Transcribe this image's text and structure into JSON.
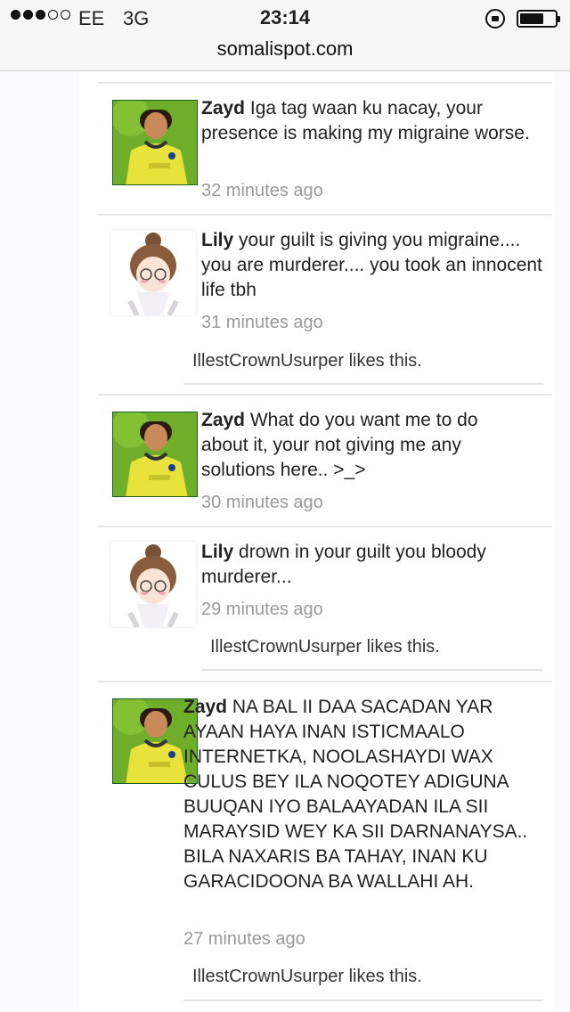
{
  "status_bar": {
    "carrier": "EE",
    "network": "3G",
    "time": "23:14"
  },
  "browser": {
    "url": "somalispot.com"
  },
  "comments": [
    {
      "author": "Zayd",
      "text": "Iga tag waan ku nacay, your presence is making my migraine worse.",
      "time": "32 minutes ago",
      "likes": ""
    },
    {
      "author": "Lily",
      "text": "your guilt is giving you migraine.... you are murderer.... you took an innocent life tbh",
      "time": "31 minutes ago",
      "likes": "IllestCrownUsurper likes this."
    },
    {
      "author": "Zayd",
      "text": "What do you want me to do about it, your not giving me any solutions here.. >_>",
      "time": "30 minutes ago",
      "likes": ""
    },
    {
      "author": "Lily",
      "text": "drown in your guilt you bloody murderer...",
      "time": "29 minutes ago",
      "likes": "IllestCrownUsurper likes this."
    },
    {
      "author": "Zayd",
      "text": "NA BAL II DAA SACADAN YAR AYAAN HAYA INAN ISTICMAALO INTERNETKA, NOOLASHAYDI WAX CULUS BEY ILA NOQOTEY ADIGUNA BUUQAN IYO BALAAYADAN ILA SII MARAYSID WEY KA SII DARNANAYSA.. BILA NAXARIS BA TAHAY, INAN KU GARACIDOONA BA WALLAHI AH.",
      "time": "27 minutes ago",
      "likes": "IllestCrownUsurper likes this."
    }
  ],
  "icons": {
    "zayd_avatar": "zayd-avatar-image",
    "lily_avatar": "lily-avatar-image",
    "lock": "orientation-lock-icon",
    "battery": "battery-icon"
  },
  "colors": {
    "zayd_avatar_bg": "#7ab82e",
    "shirt": "#e8e23a",
    "time_gray": "#9a9a9a"
  }
}
